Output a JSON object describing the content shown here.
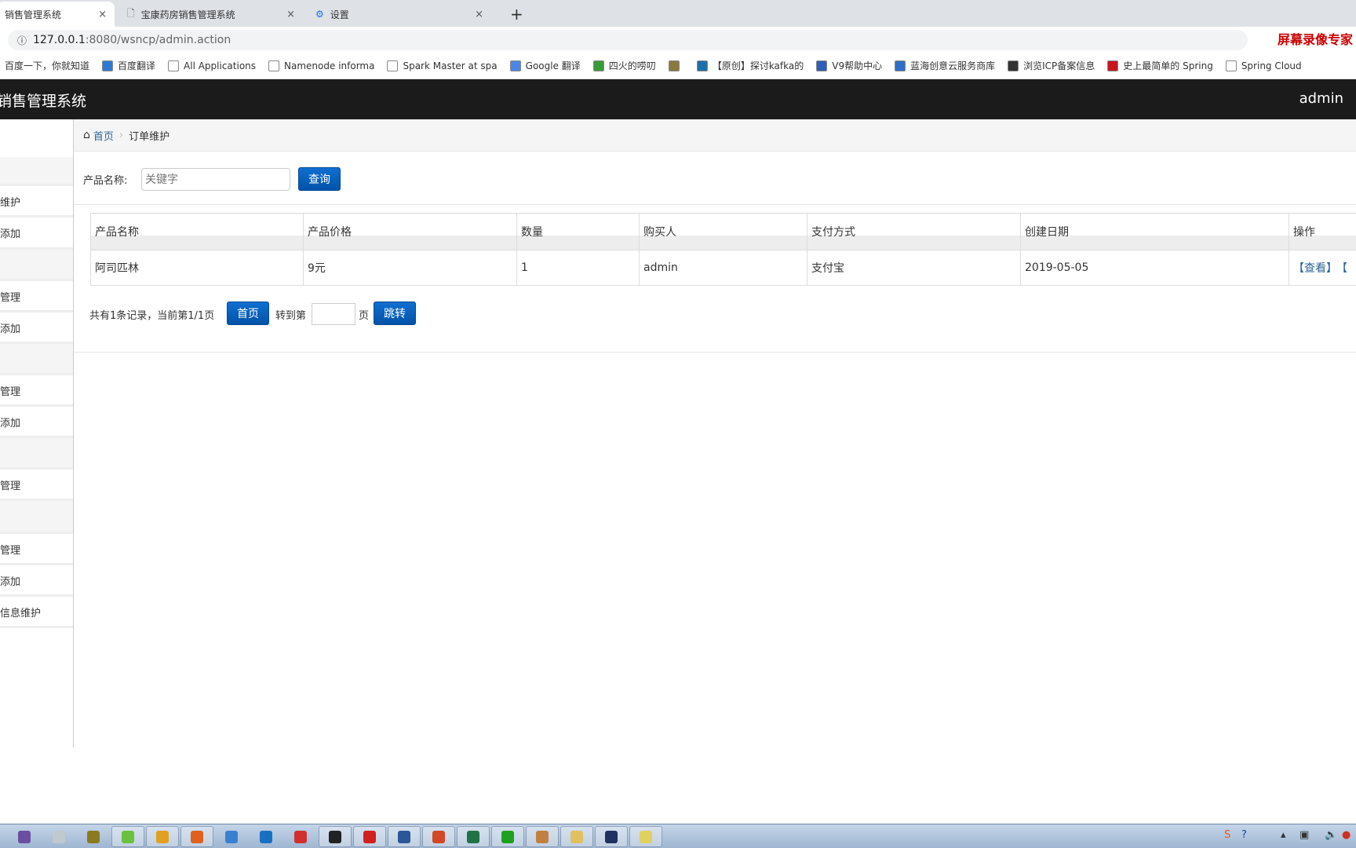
{
  "browser": {
    "tabs": [
      {
        "title": "销售管理系统",
        "active": true
      },
      {
        "title": "宝康药房销售管理系统",
        "active": false
      },
      {
        "title": "设置",
        "active": false,
        "icon": "gear-icon"
      }
    ],
    "new_tab": "+",
    "close": "×",
    "url_host": "127.0.0.1",
    "url_rest": ":8080/wsncp/admin.action",
    "recorder_watermark": "屏幕录像专家",
    "bookmarks": [
      {
        "label": "百度一下，你就知道",
        "color": "#ffffff"
      },
      {
        "label": "百度翻译",
        "color": "#2b7bd6"
      },
      {
        "label": "All Applications",
        "color": "#ffffff"
      },
      {
        "label": "Namenode informa",
        "color": "#ffffff"
      },
      {
        "label": "Spark Master at spa",
        "color": "#ffffff"
      },
      {
        "label": "Google 翻译",
        "color": "#4a86e8"
      },
      {
        "label": "四火的唠叨",
        "color": "#3a9a3a"
      },
      {
        "label": "",
        "color": "#8a7a40"
      },
      {
        "label": "【原创】探讨kafka的",
        "color": "#1d6fa8"
      },
      {
        "label": "V9帮助中心",
        "color": "#2e5eb8"
      },
      {
        "label": "蓝海创意云服务商库",
        "color": "#2e6ec8"
      },
      {
        "label": "浏览ICP备案信息",
        "color": "#333333"
      },
      {
        "label": "史上最简单的 Spring",
        "color": "#c8161d"
      },
      {
        "label": "Spring Cloud",
        "color": "#ffffff"
      }
    ]
  },
  "app": {
    "brand": "销售管理系统",
    "user": "admin",
    "sidebar": [
      {
        "label": "",
        "type": "header"
      },
      {
        "label": "维护",
        "type": "item"
      },
      {
        "label": "添加",
        "type": "item"
      },
      {
        "label": "",
        "type": "header"
      },
      {
        "label": "管理",
        "type": "item"
      },
      {
        "label": "添加",
        "type": "item"
      },
      {
        "label": "",
        "type": "header"
      },
      {
        "label": "管理",
        "type": "item"
      },
      {
        "label": "添加",
        "type": "item"
      },
      {
        "label": "",
        "type": "header"
      },
      {
        "label": "管理",
        "type": "item"
      },
      {
        "label": "",
        "type": "header"
      },
      {
        "label": "管理",
        "type": "item"
      },
      {
        "label": "添加",
        "type": "item"
      },
      {
        "label": "信息维护",
        "type": "item"
      }
    ],
    "breadcrumb": {
      "home": "首页",
      "current": "订单维护"
    },
    "search": {
      "label": "产品名称:",
      "placeholder": "关键字",
      "value": "",
      "button": "查询"
    },
    "table": {
      "columns": [
        "产品名称",
        "产品价格",
        "数量",
        "购买人",
        "支付方式",
        "创建日期",
        "操作"
      ],
      "rows": [
        {
          "name": "阿司匹林",
          "price": "9元",
          "qty": "1",
          "buyer": "admin",
          "payment": "支付宝",
          "date": "2019-05-05",
          "actions": [
            "【查看】",
            "【"
          ]
        }
      ]
    },
    "pager": {
      "summary": "共有1条记录，当前第1/1页",
      "first": "首页",
      "goto": "转到第",
      "page_unit": "页",
      "jump": "跳转",
      "page_input": ""
    }
  },
  "colors": {
    "navbar": "#1b1b1b",
    "primary_button": "#0a5fc0",
    "link": "#2a6496",
    "watermark": "#cc0000"
  }
}
